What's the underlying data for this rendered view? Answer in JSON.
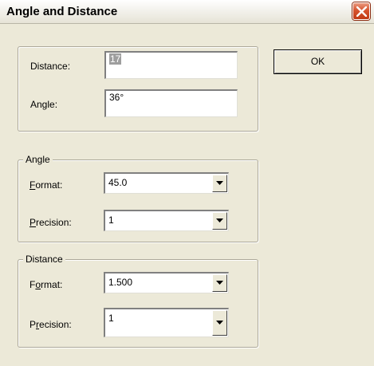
{
  "window": {
    "title": "Angle and Distance",
    "close_icon": "close-icon"
  },
  "top_fields": {
    "distance_label": "Distance:",
    "distance_value": "17",
    "angle_label": "Angle:",
    "angle_value": "36°"
  },
  "ok_button": {
    "label": "OK"
  },
  "angle_group": {
    "title": "Angle",
    "format_label_mnemonic": "F",
    "format_label_rest": "ormat:",
    "format_value": "45.0",
    "precision_label_mnemonic": "P",
    "precision_label_rest": "recision:",
    "precision_value": "1"
  },
  "distance_group": {
    "title": "Distance",
    "format_label_pre": "F",
    "format_label_mnemonic": "o",
    "format_label_rest": "rmat:",
    "format_value": "1.500",
    "precision_label_pre": "P",
    "precision_label_mnemonic": "r",
    "precision_label_rest": "ecision:",
    "precision_value": "1"
  },
  "colors": {
    "dialog_bg": "#ece9d8",
    "close_red": "#d6532e",
    "selection_gray": "#9e9e9e"
  }
}
